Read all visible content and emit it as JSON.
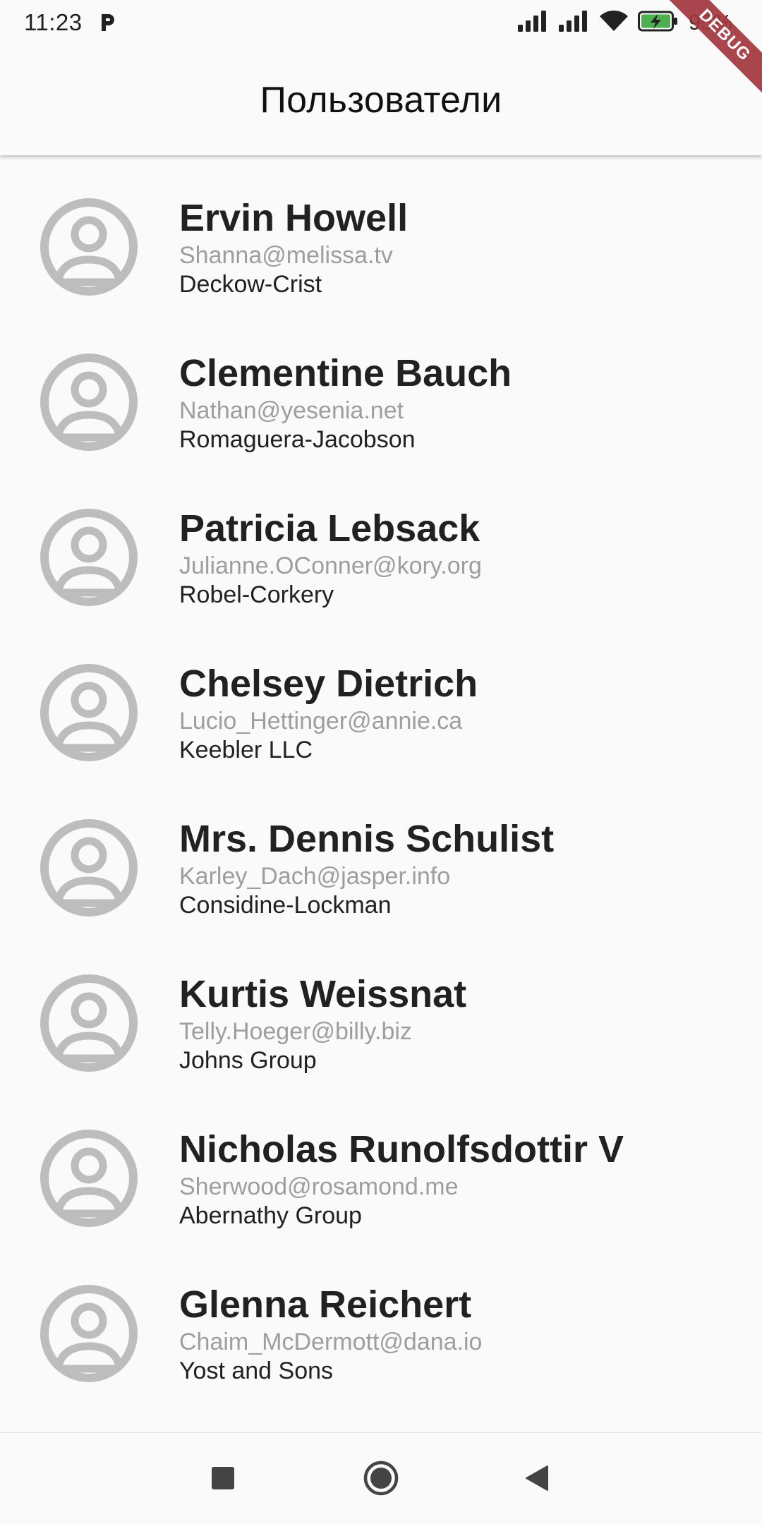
{
  "status_bar": {
    "time": "11:23",
    "battery": "95%",
    "icons": [
      "p-icon",
      "signal-icon",
      "signal-icon",
      "wifi-icon",
      "battery-charging-icon"
    ]
  },
  "debug_banner": "DEBUG",
  "app_bar": {
    "title": "Пользователи"
  },
  "users": [
    {
      "name": "Ervin Howell",
      "email": "Shanna@melissa.tv",
      "company": "Deckow-Crist"
    },
    {
      "name": "Clementine Bauch",
      "email": "Nathan@yesenia.net",
      "company": "Romaguera-Jacobson"
    },
    {
      "name": "Patricia Lebsack",
      "email": "Julianne.OConner@kory.org",
      "company": "Robel-Corkery"
    },
    {
      "name": "Chelsey Dietrich",
      "email": "Lucio_Hettinger@annie.ca",
      "company": "Keebler LLC"
    },
    {
      "name": "Mrs. Dennis Schulist",
      "email": "Karley_Dach@jasper.info",
      "company": "Considine-Lockman"
    },
    {
      "name": "Kurtis Weissnat",
      "email": "Telly.Hoeger@billy.biz",
      "company": "Johns Group"
    },
    {
      "name": "Nicholas Runolfsdottir V",
      "email": "Sherwood@rosamond.me",
      "company": "Abernathy Group"
    },
    {
      "name": "Glenna Reichert",
      "email": "Chaim_McDermott@dana.io",
      "company": "Yost and Sons"
    }
  ],
  "nav_bar": {
    "icons": [
      "recents-square-icon",
      "home-circle-icon",
      "back-triangle-icon"
    ]
  },
  "colors": {
    "background": "#fafafa",
    "avatar": "#bdbdbd",
    "name": "#212121",
    "email": "#9e9e9e",
    "debug": "#a3363e",
    "battery_fill": "#4caf50"
  }
}
